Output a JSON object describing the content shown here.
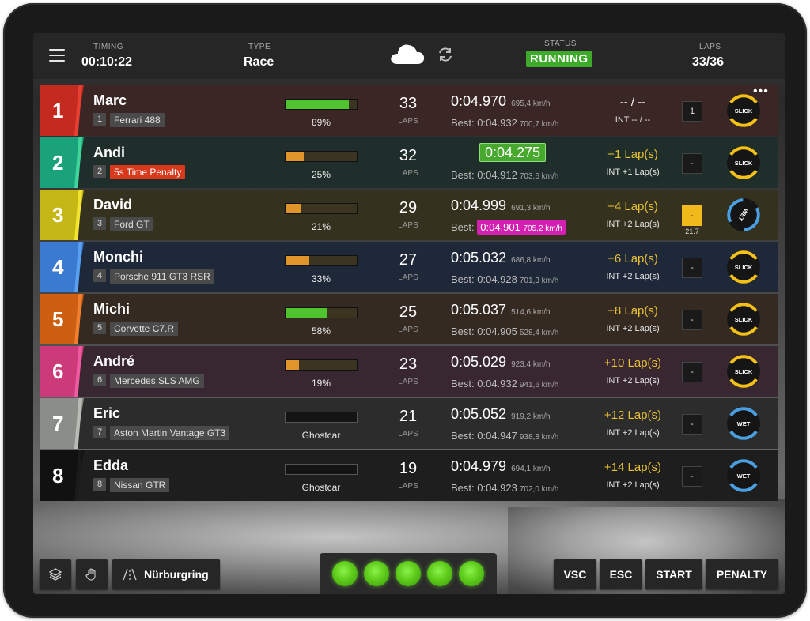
{
  "header": {
    "timing_label": "TIMING",
    "timing_value": "00:10:22",
    "type_label": "TYPE",
    "type_value": "Race",
    "status_label": "STATUS",
    "status_value": "RUNNING",
    "laps_label": "LAPS",
    "laps_value": "33/36",
    "weather_icon": "cloud-icon",
    "refresh_icon": "refresh-icon"
  },
  "colors": {
    "running": "#3daa2a",
    "best_purple": "#d41fb2",
    "gap_yellow": "#e8c233",
    "slick": "#f2c016",
    "wet": "#4a9fe0"
  },
  "drivers": [
    {
      "pos": "1",
      "name": "Marc",
      "num": "1",
      "car": "Ferrari 488",
      "progress": 89,
      "progress_text": "89%",
      "laps": "33",
      "laps_label": "LAPS",
      "lap_time": "0:04.970",
      "speed": "695,4 km/h",
      "best_label": "Best:",
      "best_time": "0:04.932",
      "best_speed": "700,7 km/h",
      "gap": "-- / --",
      "int": "INT -- / --",
      "pit": "1",
      "pit_sub": "",
      "tyre": "SLICK",
      "more": "•••"
    },
    {
      "pos": "2",
      "name": "Andi",
      "num": "2",
      "car": "5s Time Penalty",
      "progress": 25,
      "progress_text": "25%",
      "laps": "32",
      "laps_label": "LAPS",
      "lap_time": "0:04.275",
      "speed": "",
      "best_label": "Best:",
      "best_time": "0:04.912",
      "best_speed": "703,6 km/h",
      "gap": "+1 Lap(s)",
      "int": "INT +1 Lap(s)",
      "pit": "-",
      "pit_sub": "",
      "tyre": "SLICK"
    },
    {
      "pos": "3",
      "name": "David",
      "num": "3",
      "car": "Ford GT",
      "progress": 21,
      "progress_text": "21%",
      "laps": "29",
      "laps_label": "LAPS",
      "lap_time": "0:04.999",
      "speed": "691,3 km/h",
      "best_label": "Best:",
      "best_time": "0:04.901",
      "best_speed": "705,2 km/h",
      "gap": "+4 Lap(s)",
      "int": "INT +2 Lap(s)",
      "pit": "-",
      "pit_sub": "21.7",
      "tyre": "WET"
    },
    {
      "pos": "4",
      "name": "Monchi",
      "num": "4",
      "car": "Porsche 911 GT3 RSR",
      "progress": 33,
      "progress_text": "33%",
      "laps": "27",
      "laps_label": "LAPS",
      "lap_time": "0:05.032",
      "speed": "686,8 km/h",
      "best_label": "Best:",
      "best_time": "0:04.928",
      "best_speed": "701,3 km/h",
      "gap": "+6 Lap(s)",
      "int": "INT +2 Lap(s)",
      "pit": "-",
      "pit_sub": "",
      "tyre": "SLICK"
    },
    {
      "pos": "5",
      "name": "Michi",
      "num": "5",
      "car": "Corvette C7.R",
      "progress": 58,
      "progress_text": "58%",
      "laps": "25",
      "laps_label": "LAPS",
      "lap_time": "0:05.037",
      "speed": "514,6 km/h",
      "best_label": "Best:",
      "best_time": "0:04.905",
      "best_speed": "528,4 km/h",
      "gap": "+8 Lap(s)",
      "int": "INT +2 Lap(s)",
      "pit": "-",
      "pit_sub": "",
      "tyre": "SLICK"
    },
    {
      "pos": "6",
      "name": "André",
      "num": "6",
      "car": "Mercedes SLS AMG",
      "progress": 19,
      "progress_text": "19%",
      "laps": "23",
      "laps_label": "LAPS",
      "lap_time": "0:05.029",
      "speed": "923,4 km/h",
      "best_label": "Best:",
      "best_time": "0:04.932",
      "best_speed": "941,6 km/h",
      "gap": "+10 Lap(s)",
      "int": "INT +2 Lap(s)",
      "pit": "-",
      "pit_sub": "",
      "tyre": "SLICK"
    },
    {
      "pos": "7",
      "name": "Eric",
      "num": "7",
      "car": "Aston Martin Vantage GT3",
      "progress": 0,
      "progress_text": "Ghostcar",
      "laps": "21",
      "laps_label": "LAPS",
      "lap_time": "0:05.052",
      "speed": "919,2 km/h",
      "best_label": "Best:",
      "best_time": "0:04.947",
      "best_speed": "938,8 km/h",
      "gap": "+12 Lap(s)",
      "int": "INT +2 Lap(s)",
      "pit": "-",
      "pit_sub": "",
      "tyre": "WET"
    },
    {
      "pos": "8",
      "name": "Edda",
      "num": "8",
      "car": "Nissan GTR",
      "progress": 0,
      "progress_text": "Ghostcar",
      "laps": "19",
      "laps_label": "LAPS",
      "lap_time": "0:04.979",
      "speed": "694,1 km/h",
      "best_label": "Best:",
      "best_time": "0:04.923",
      "best_speed": "702,0 km/h",
      "gap": "+14 Lap(s)",
      "int": "INT +2 Lap(s)",
      "pit": "-",
      "pit_sub": "",
      "tyre": "WET"
    }
  ],
  "footer": {
    "track_icon": "track-icon",
    "track_name": "Nürburgring",
    "layers_icon": "layers-icon",
    "hand_icon": "hand-icon",
    "lights_count": 5,
    "vsc": "VSC",
    "esc": "ESC",
    "start": "START",
    "penalty": "PENALTY"
  }
}
